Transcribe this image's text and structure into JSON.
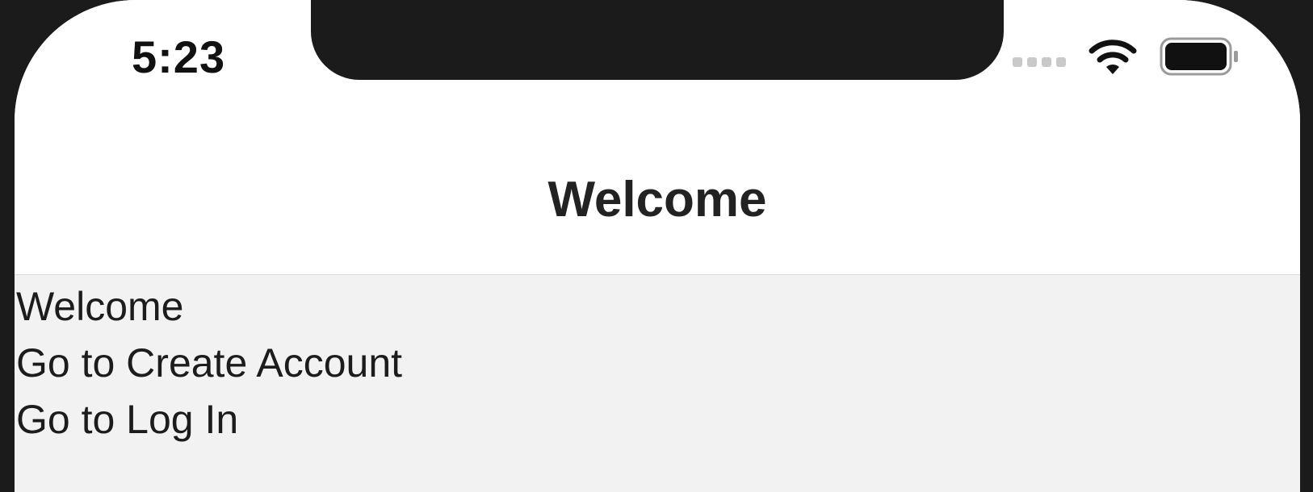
{
  "status_bar": {
    "time": "5:23",
    "icons": [
      "signal-dots-icon",
      "wifi-icon",
      "battery-icon"
    ]
  },
  "nav_bar": {
    "title": "Welcome"
  },
  "content": {
    "heading": "Welcome",
    "links": [
      {
        "label": "Go to Create Account"
      },
      {
        "label": "Go to Log In"
      }
    ]
  },
  "colors": {
    "bezel": "#1b1b1b",
    "nav_background": "#ffffff",
    "content_background": "#f2f2f2",
    "text": "#1c1c1c"
  }
}
